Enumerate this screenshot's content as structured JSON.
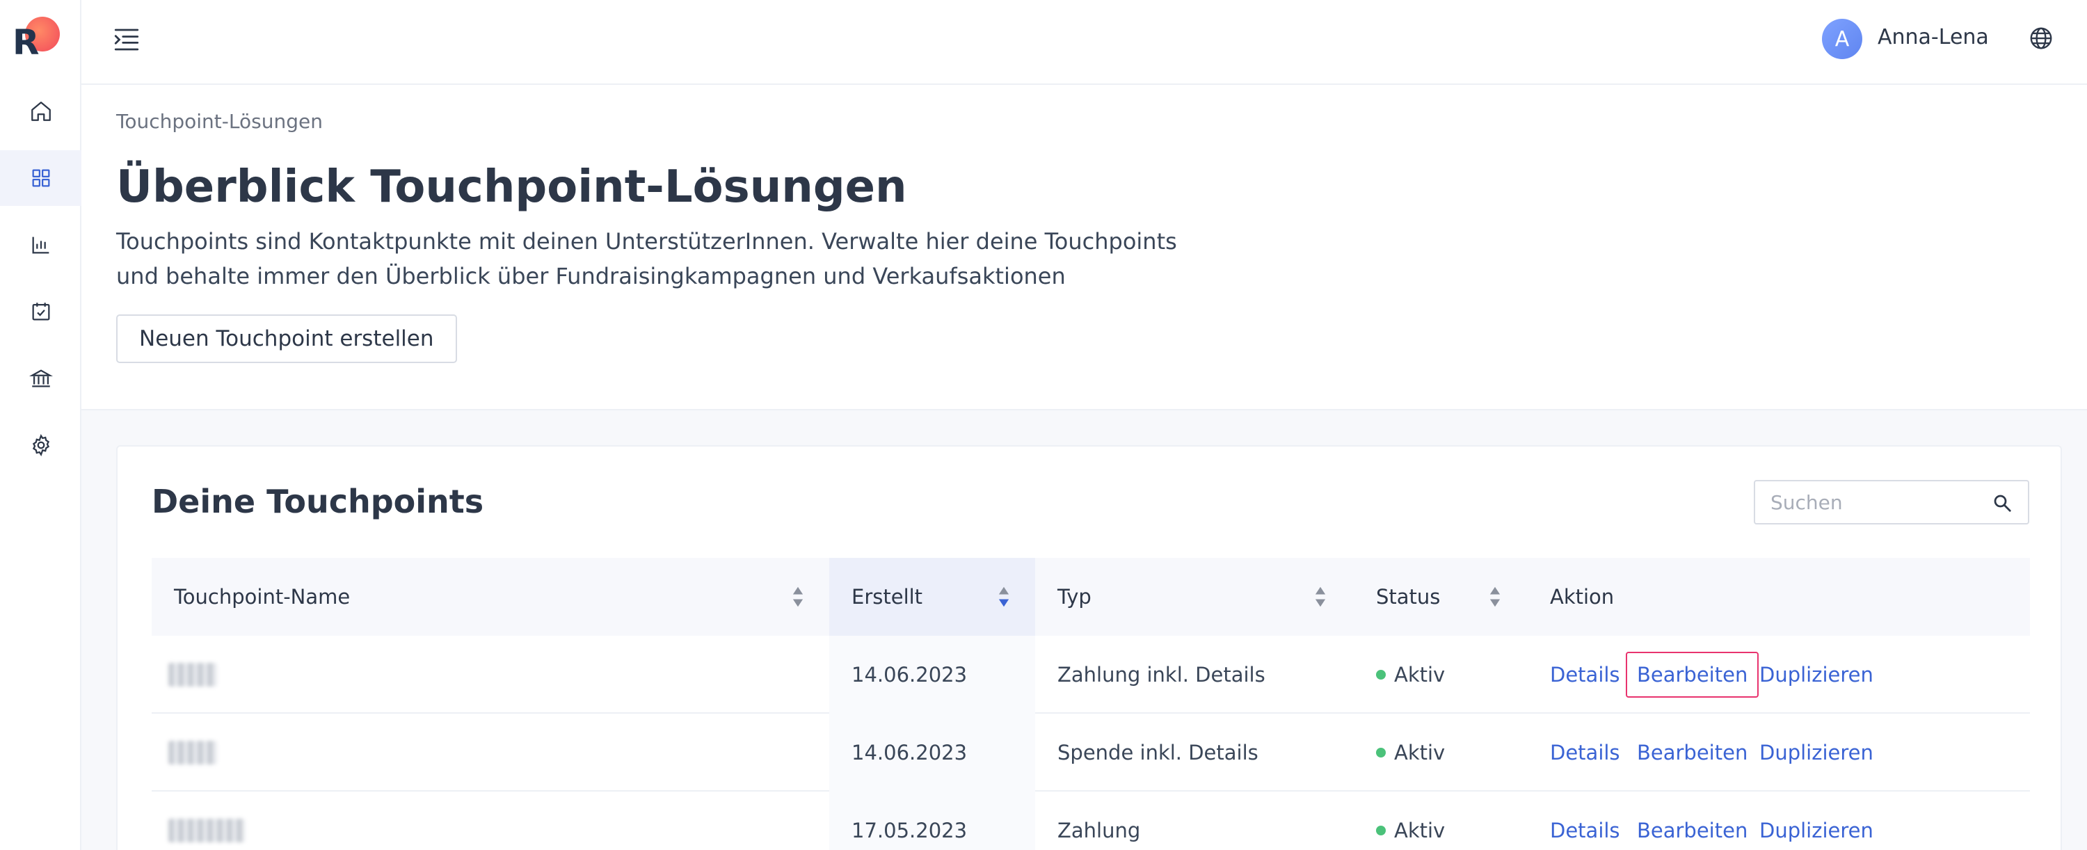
{
  "app": {
    "logo_letter": "R"
  },
  "sidebar": {
    "items": [
      {
        "name": "home",
        "icon": "home-icon",
        "active": false
      },
      {
        "name": "touchpoints",
        "icon": "grid-icon",
        "active": true
      },
      {
        "name": "statistics",
        "icon": "bar-chart-icon",
        "active": false
      },
      {
        "name": "tasks",
        "icon": "calendar-check-icon",
        "active": false
      },
      {
        "name": "bank",
        "icon": "bank-icon",
        "active": false
      },
      {
        "name": "settings",
        "icon": "gear-icon",
        "active": false
      }
    ]
  },
  "topbar": {
    "avatar_initial": "A",
    "username": "Anna-Lena"
  },
  "header": {
    "breadcrumb": "Touchpoint-Lösungen",
    "title": "Überblick Touchpoint-Lösungen",
    "description": "Touchpoints sind Kontaktpunkte mit deinen UnterstützerInnen. Verwalte hier deine Touchpoints und behalte immer den Überblick über Fundraisingkampagnen und Verkaufsaktionen",
    "new_button": "Neuen Touchpoint erstellen"
  },
  "card": {
    "title": "Deine Touchpoints",
    "search_placeholder": "Suchen"
  },
  "table": {
    "columns": [
      "Touchpoint-Name",
      "Erstellt",
      "Typ",
      "Status",
      "Aktion"
    ],
    "rows": [
      {
        "name": "",
        "created": "14.06.2023",
        "type": "Zahlung inkl. Details",
        "status": "Aktiv",
        "actions": [
          "Details",
          "Bearbeiten",
          "Duplizieren"
        ]
      },
      {
        "name": "",
        "created": "14.06.2023",
        "type": "Spende inkl. Details",
        "status": "Aktiv",
        "actions": [
          "Details",
          "Bearbeiten",
          "Duplizieren"
        ]
      },
      {
        "name": "",
        "created": "17.05.2023",
        "type": "Zahlung",
        "status": "Aktiv",
        "actions": [
          "Details",
          "Bearbeiten",
          "Duplizieren"
        ]
      }
    ]
  },
  "colors": {
    "accent": "#3a63d4",
    "status_active": "#4bc27a",
    "highlight": "#e8336e",
    "text": "#2d3748"
  }
}
